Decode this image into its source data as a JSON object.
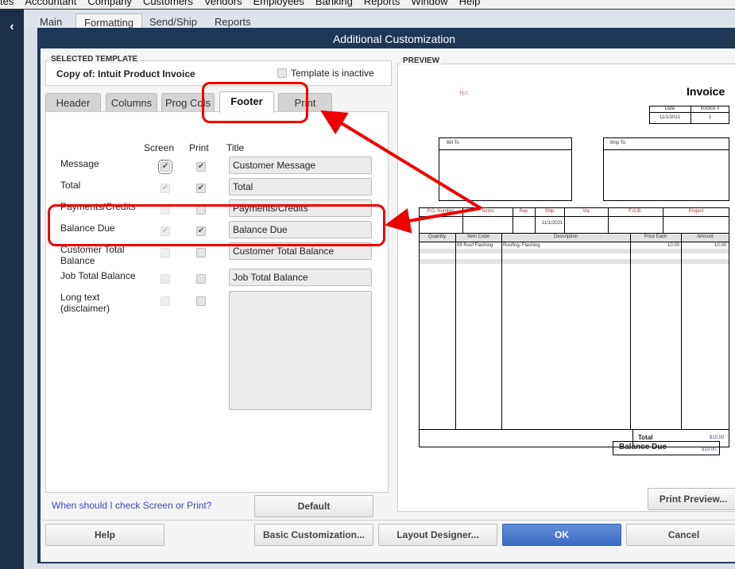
{
  "menubar": [
    "tes",
    "Accountant",
    "Company",
    "Customers",
    "Vendors",
    "Employees",
    "Banking",
    "Reports",
    "Window",
    "Help"
  ],
  "app_tabs": [
    "Main",
    "Formatting",
    "Send/Ship",
    "Reports"
  ],
  "dialog": {
    "title": "Additional Customization",
    "selected_template_label": "SELECTED TEMPLATE",
    "template_name": "Copy of: Intuit Product Invoice",
    "inactive_label": "Template is inactive",
    "inactive_checked": false,
    "tabs": [
      "Header",
      "Columns",
      "Prog Cols",
      "Footer",
      "Print"
    ],
    "active_tab": "Footer",
    "columns": {
      "screen": "Screen",
      "print": "Print",
      "title": "Title"
    },
    "rows": [
      {
        "label": "Message",
        "screen": true,
        "screen_enabled": true,
        "print": true,
        "title": "Customer Message"
      },
      {
        "label": "Total",
        "screen": true,
        "screen_enabled": false,
        "print": true,
        "title": "Total"
      },
      {
        "label": "Payments/Credits",
        "screen": false,
        "screen_enabled": false,
        "print": false,
        "title": "Payments/Credits"
      },
      {
        "label": "Balance Due",
        "screen": true,
        "screen_enabled": false,
        "print": true,
        "title": "Balance Due"
      },
      {
        "label": "Customer Total Balance",
        "screen": false,
        "screen_enabled": false,
        "print": false,
        "title": "Customer Total Balance"
      },
      {
        "label": "Job Total Balance",
        "screen": false,
        "screen_enabled": false,
        "print": false,
        "title": "Job Total Balance"
      },
      {
        "label": "Long text (disclaimer)",
        "screen": false,
        "screen_enabled": false,
        "print": false,
        "title": ""
      }
    ],
    "help_link": "When should I check Screen or Print?",
    "default_button": "Default",
    "preview_label": "PREVIEW",
    "print_preview_button": "Print Preview...",
    "buttons": {
      "help": "Help",
      "basic": "Basic Customization...",
      "layout": "Layout Designer...",
      "ok": "OK",
      "cancel": "Cancel"
    }
  },
  "invoice": {
    "company": "TLC",
    "title": "Invoice",
    "date_h": "Date",
    "num_h": "Invoice #",
    "date": "11/1/2021",
    "num": "1",
    "bill_to": "Bill To",
    "ship_to": "Ship To",
    "po_headers": [
      "P.O. Number",
      "Terms",
      "Rep",
      "Ship",
      "Via",
      "F.O.B.",
      "Project"
    ],
    "ship_date": "11/1/2021",
    "item_headers": [
      "Quantity",
      "Item Code",
      "Description",
      "Price Each",
      "Amount"
    ],
    "item": {
      "code": "09 Roof Flashing",
      "desc": "Roofing, Flashing",
      "price": "10.00",
      "amount": "10.00"
    },
    "total_label": "Total",
    "total": "$10.00",
    "balance_label": "Balance Due",
    "balance": "$10.00"
  },
  "colors": {
    "annotation": "#ee0000",
    "title_bar": "#1e3755",
    "ok": "#4a7bd0"
  }
}
